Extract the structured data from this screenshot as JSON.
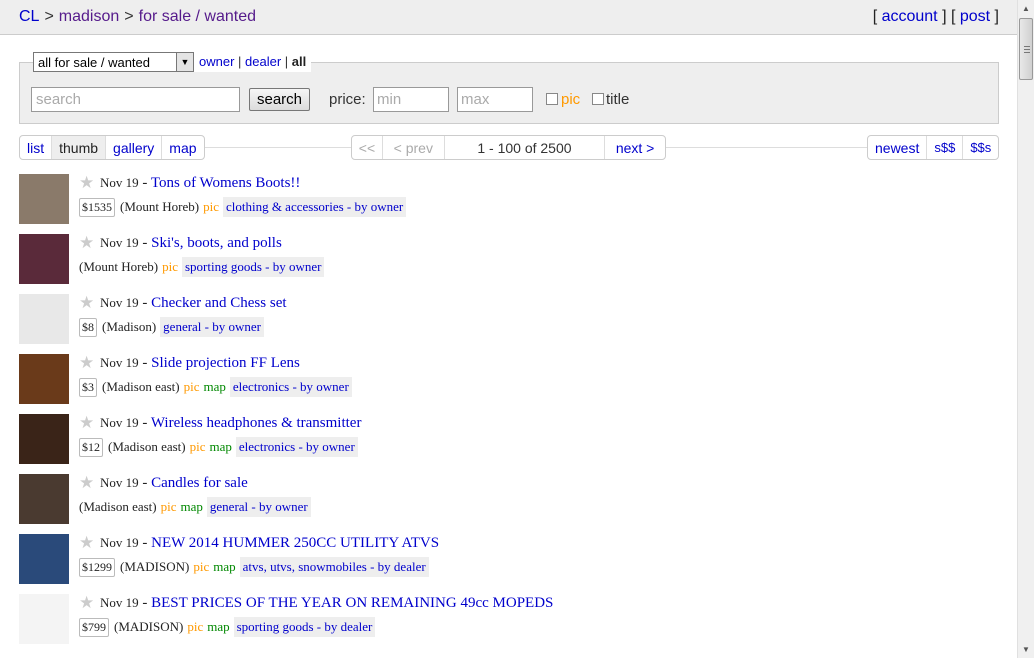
{
  "header": {
    "crumbs": [
      "CL",
      "madison",
      "for sale / wanted"
    ],
    "crumb_sep": ">",
    "account_label": "account",
    "post_label": "post"
  },
  "search": {
    "category_selected": "all for sale / wanted",
    "owner_label": "owner",
    "dealer_label": "dealer",
    "all_label": "all",
    "placeholder": "search",
    "button_label": "search",
    "price_label": "price:",
    "min_placeholder": "min",
    "max_placeholder": "max",
    "pic_label": "pic",
    "title_label": "title"
  },
  "toolbar": {
    "views": [
      "list",
      "thumb",
      "gallery",
      "map"
    ],
    "selected_view": "thumb",
    "first_label": "<<",
    "prev_label": "< prev",
    "range": "1 - 100 of 2500",
    "next_label": "next >",
    "sorts": [
      "newest",
      "s$$",
      "$$s"
    ]
  },
  "listings": [
    {
      "date": "Nov 19",
      "title": "Tons of Womens Boots!!",
      "price": "$1535",
      "location": "(Mount Horeb)",
      "pic": "pic",
      "map": "",
      "category": "clothing & accessories - by owner",
      "thumb_color": "#8a7a6a"
    },
    {
      "date": "Nov 19",
      "title": "Ski's, boots, and polls",
      "price": "",
      "location": "(Mount Horeb)",
      "pic": "pic",
      "map": "",
      "category": "sporting goods - by owner",
      "thumb_color": "#5a2a3a"
    },
    {
      "date": "Nov 19",
      "title": "Checker and Chess set",
      "price": "$8",
      "location": "(Madison)",
      "pic": "",
      "map": "",
      "category": "general - by owner",
      "thumb_color": "#e8e8e8"
    },
    {
      "date": "Nov 19",
      "title": "Slide projection FF Lens",
      "price": "$3",
      "location": "(Madison east)",
      "pic": "pic",
      "map": "map",
      "category": "electronics - by owner",
      "thumb_color": "#6a3a1a"
    },
    {
      "date": "Nov 19",
      "title": "Wireless headphones & transmitter",
      "price": "$12",
      "location": "(Madison east)",
      "pic": "pic",
      "map": "map",
      "category": "electronics - by owner",
      "thumb_color": "#3a2418"
    },
    {
      "date": "Nov 19",
      "title": "Candles for sale",
      "price": "",
      "location": "(Madison east)",
      "pic": "pic",
      "map": "map",
      "category": "general - by owner",
      "thumb_color": "#4a3a30"
    },
    {
      "date": "Nov 19",
      "title": "NEW 2014 HUMMER 250CC UTILITY ATVS",
      "price": "$1299",
      "location": "(MADISON)",
      "pic": "pic",
      "map": "map",
      "category": "atvs, utvs, snowmobiles - by dealer",
      "thumb_color": "#2a4a7a"
    },
    {
      "date": "Nov 19",
      "title": "BEST PRICES OF THE YEAR ON REMAINING 49cc MOPEDS",
      "price": "$799",
      "location": "(MADISON)",
      "pic": "pic",
      "map": "map",
      "category": "sporting goods - by dealer",
      "thumb_color": "#f4f4f4"
    }
  ],
  "colors": {
    "link": "#0000cc",
    "visited": "#551a8b",
    "pic_tag": "#ff9900",
    "map_tag": "#008800",
    "tag_bg": "#eeeeee"
  }
}
